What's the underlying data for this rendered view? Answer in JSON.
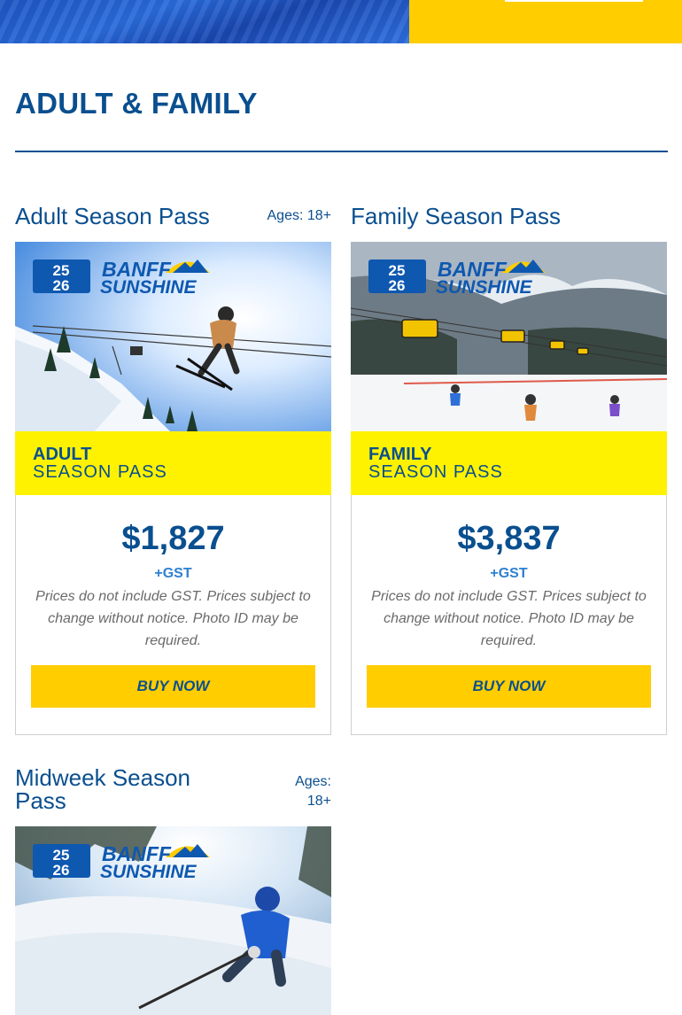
{
  "section": {
    "title": "ADULT & FAMILY"
  },
  "cards": [
    {
      "title": "Adult Season Pass",
      "ages": "Ages: 18+",
      "logo_line1": "BANFF",
      "logo_line2": "SUNSHINE",
      "logo_years": [
        "25",
        "26"
      ],
      "band_line1": "ADULT",
      "band_line2": "SEASON PASS",
      "price": "$1,827",
      "tax": "+GST",
      "note": "Prices do not include GST. Prices subject to change without notice. Photo ID may be required.",
      "button": "BUY NOW"
    },
    {
      "title": "Family Season Pass",
      "logo_line1": "BANFF",
      "logo_line2": "SUNSHINE",
      "logo_years": [
        "25",
        "26"
      ],
      "band_line1": "FAMILY",
      "band_line2": "SEASON PASS",
      "price": "$3,837",
      "tax": "+GST",
      "note": "Prices do not include GST. Prices subject to change without notice. Photo ID may be required.",
      "button": "BUY NOW"
    },
    {
      "title": "Midweek Season Pass",
      "ages_line1": "Ages:",
      "ages_line2": "18+",
      "logo_line1": "BANFF",
      "logo_line2": "SUNSHINE",
      "logo_years": [
        "25",
        "26"
      ]
    }
  ],
  "colors": {
    "brand_blue": "#0a4f8f",
    "accent_yellow": "#ffcd00",
    "band_yellow": "#fff200"
  }
}
